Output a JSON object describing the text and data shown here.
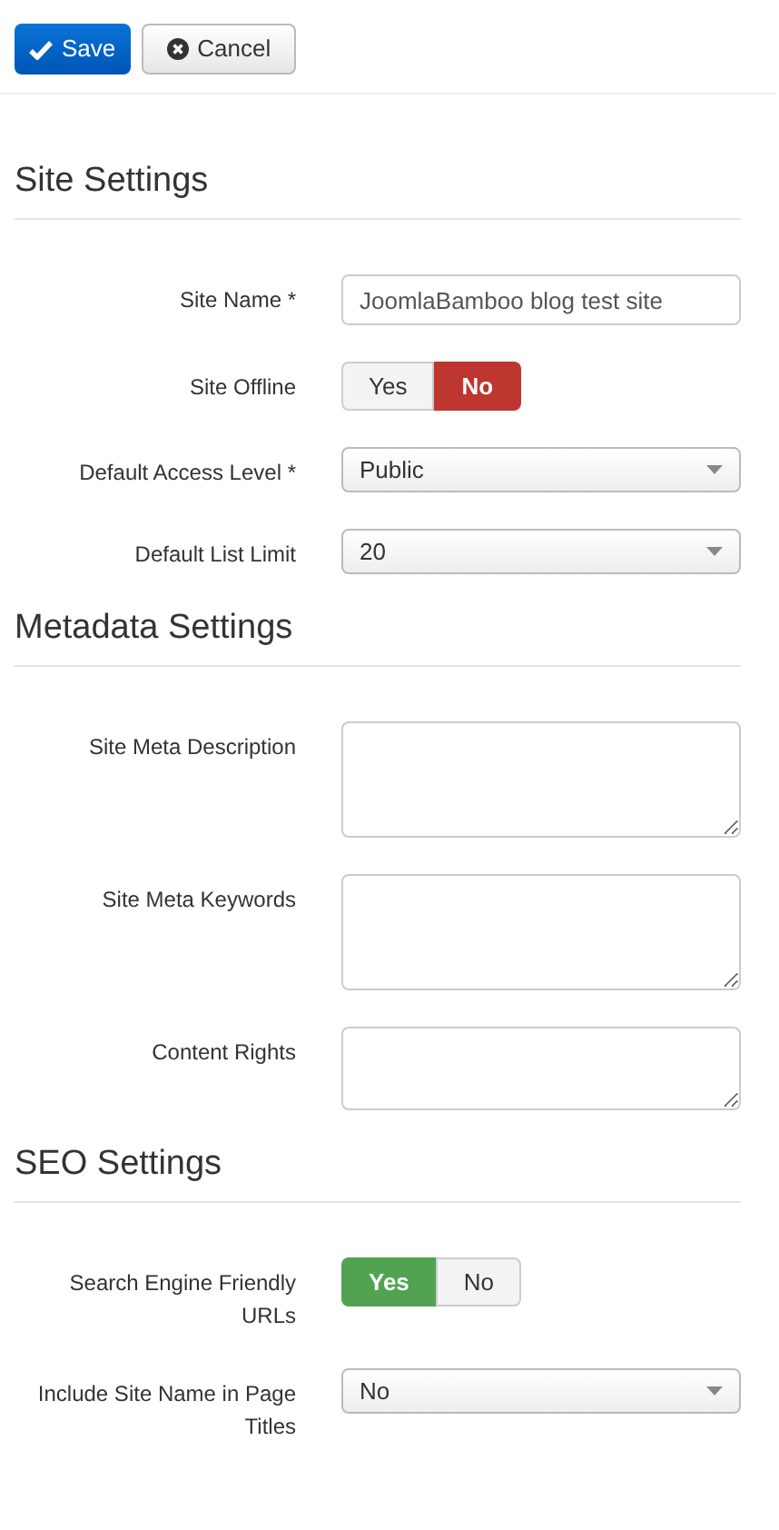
{
  "toolbar": {
    "buttons": [
      {
        "label": "Save",
        "kind": "primary"
      },
      {
        "label": "Cancel",
        "kind": "default"
      }
    ]
  },
  "sections": [
    {
      "title": "Site Settings",
      "fields": [
        {
          "label": "Site Name *",
          "kind": "text",
          "value": "JoomlaBamboo blog test site"
        },
        {
          "label": "Site Offline",
          "kind": "toggle",
          "options": [
            {
              "label": "Yes",
              "selected": false
            },
            {
              "label": "No",
              "selected": true,
              "color": "#bd362f"
            }
          ]
        },
        {
          "label": "Default Access Level *",
          "kind": "select",
          "value": "Public"
        },
        {
          "label": "Default List Limit",
          "kind": "select",
          "value": "20"
        }
      ]
    },
    {
      "title": "Metadata Settings",
      "fields": [
        {
          "label": "Site Meta Description",
          "kind": "textarea"
        },
        {
          "label": "Site Meta Keywords",
          "kind": "textarea"
        },
        {
          "label": "Content Rights",
          "kind": "shortarea"
        }
      ]
    },
    {
      "title": "SEO Settings",
      "fields": [
        {
          "label": "Search Engine Friendly URLs",
          "kind": "toggle",
          "options": [
            {
              "label": "Yes",
              "selected": true,
              "color": "#51a351"
            },
            {
              "label": "No",
              "selected": false
            }
          ]
        },
        {
          "label": "Include Site Name in Page Titles",
          "kind": "select",
          "value": "No"
        }
      ]
    }
  ]
}
